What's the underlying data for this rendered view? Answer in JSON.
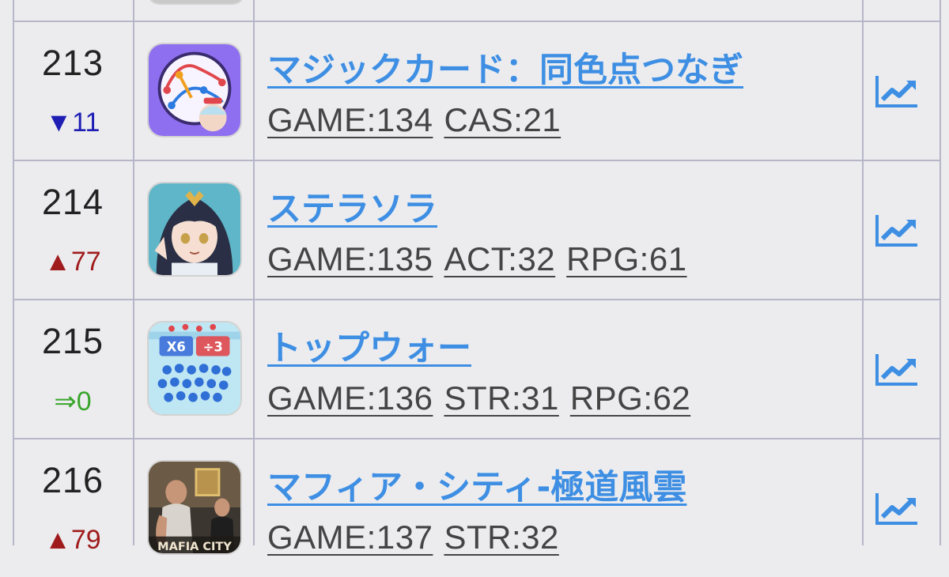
{
  "colors": {
    "link": "#3e8fe3",
    "down": "#1e1eb4",
    "up": "#a01c1c",
    "same": "#3aa52c",
    "border": "#b6b6c8",
    "background": "#ececef"
  },
  "rows": [
    {
      "rank": "213",
      "change": "▼11",
      "change_dir": "down",
      "icon": "dot-connect-puzzle-icon",
      "title": "マジックカード：同色点つなぎ",
      "tags": [
        "GAME:134",
        "CAS:21"
      ],
      "chart_icon": "trend-chart-icon"
    },
    {
      "rank": "214",
      "change": "▲77",
      "change_dir": "up",
      "icon": "anime-girl-portrait-icon",
      "title": "ステラソラ",
      "tags": [
        "GAME:135",
        "ACT:32",
        "RPG:61"
      ],
      "chart_icon": "trend-chart-icon"
    },
    {
      "rank": "215",
      "change": "⇒0",
      "change_dir": "same",
      "icon": "crowd-runner-game-icon",
      "title": "トップウォー",
      "tags": [
        "GAME:136",
        "STR:31",
        "RPG:62"
      ],
      "chart_icon": "trend-chart-icon",
      "icon_labels": [
        "X6",
        "÷3"
      ]
    },
    {
      "rank": "216",
      "change": "▲79",
      "change_dir": "up",
      "icon": "mafia-city-game-icon",
      "title": "マフィア・シティ-極道風雲",
      "tags": [
        "GAME:137",
        "STR:32"
      ],
      "chart_icon": "trend-chart-icon",
      "icon_labels": [
        "MAFIA CITY"
      ]
    }
  ]
}
